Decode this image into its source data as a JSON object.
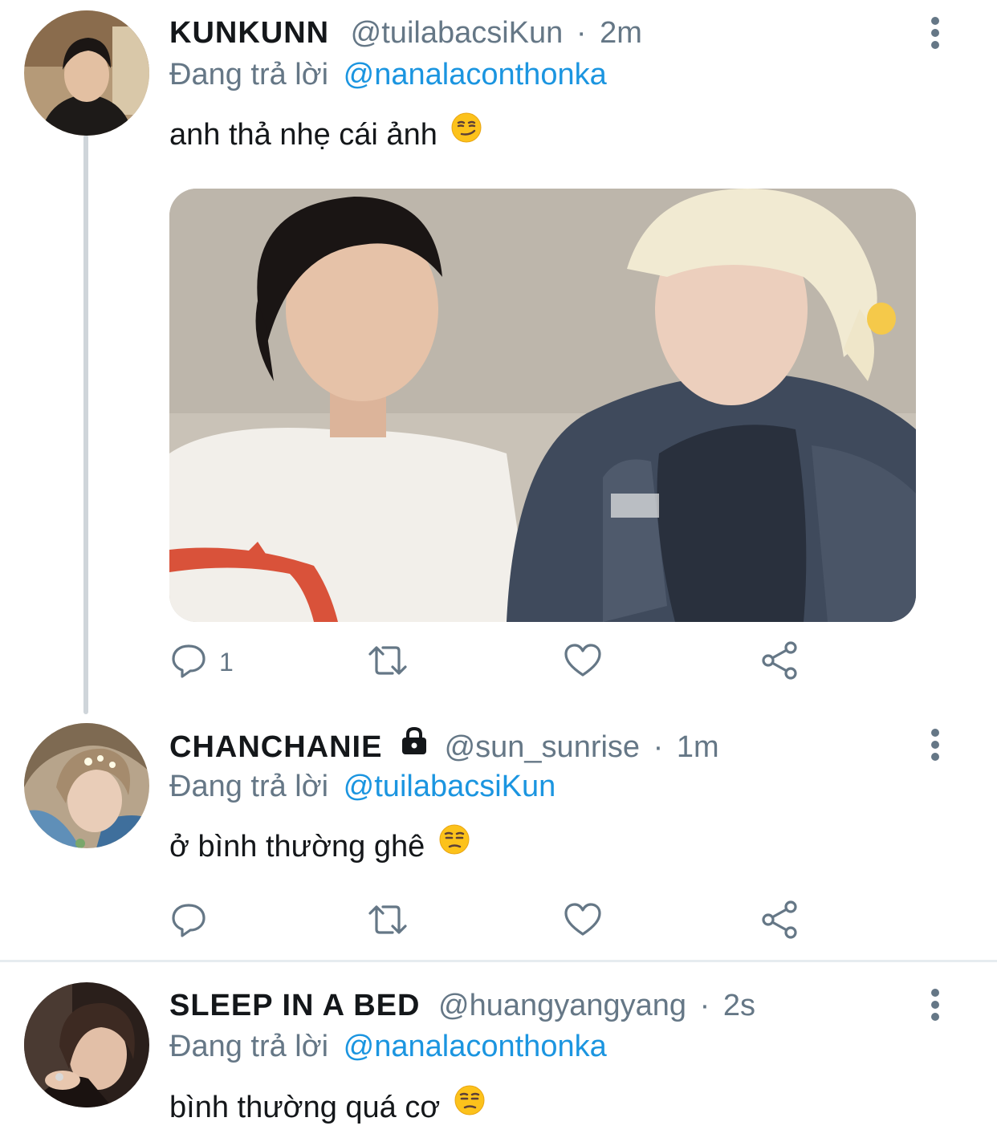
{
  "tweets": [
    {
      "display_name": "KUNKUNN",
      "handle": "@tuilabacsiKun",
      "separator": "·",
      "time": "2m",
      "reply_prefix": "Đang trả lời",
      "reply_to": "@nanalaconthonka",
      "text": "anh thả nhẹ cái ảnh",
      "emoji": "smirking-face",
      "has_media": true,
      "reply_count": "1",
      "locked": false
    },
    {
      "display_name": "CHANCHANIE",
      "handle": "@sun_sunrise",
      "separator": "·",
      "time": "1m",
      "reply_prefix": "Đang trả lời",
      "reply_to": "@tuilabacsiKun",
      "text": "ở bình thường ghê",
      "emoji": "unamused-face",
      "has_media": false,
      "reply_count": "",
      "locked": true
    },
    {
      "display_name": "SLEEP IN A BED",
      "handle": "@huangyangyang",
      "separator": "·",
      "time": "2s",
      "reply_prefix": "Đang trả lời",
      "reply_to": "@nanalaconthonka",
      "text": "bình thường quá cơ",
      "emoji": "unamused-face",
      "has_media": false,
      "reply_count": "",
      "locked": false
    }
  ],
  "colors": {
    "name": "#14171a",
    "secondary": "#657786",
    "link": "#1b95e0",
    "thread_line": "#cfd5da",
    "divider": "#e6ecf0"
  },
  "icons": [
    "reply-icon",
    "retweet-icon",
    "like-icon",
    "share-icon",
    "more-icon",
    "lock-icon"
  ]
}
